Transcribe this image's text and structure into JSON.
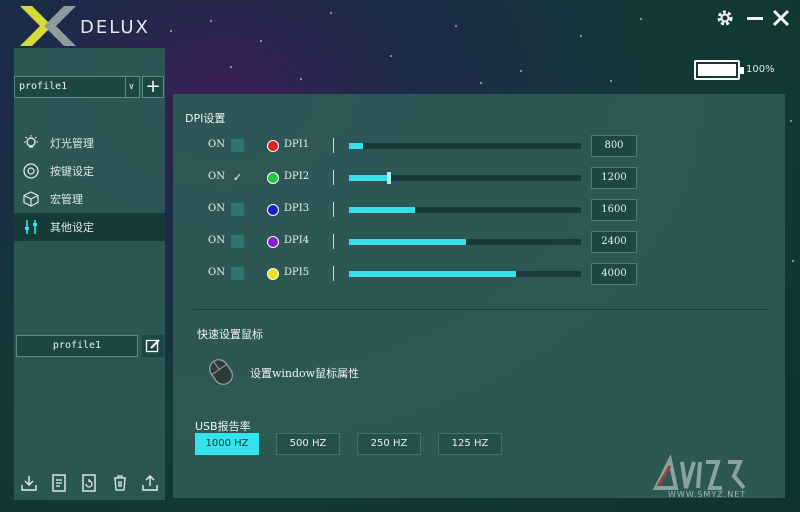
{
  "brand": {
    "logo_text": "DELUX"
  },
  "topbar": {
    "battery_text": "100%"
  },
  "sidebar": {
    "profile_select_value": "profile1",
    "profile_name": "profile1",
    "items": [
      {
        "label": "灯光管理",
        "icon": "light-bulb-icon"
      },
      {
        "label": "按键设定",
        "icon": "mouse-buttons-icon"
      },
      {
        "label": "宏管理",
        "icon": "macro-cube-icon"
      },
      {
        "label": "其他设定",
        "icon": "sliders-icon"
      }
    ],
    "bottom_tools": [
      "import-icon",
      "document-icon",
      "refresh-icon",
      "trash-icon",
      "export-icon"
    ]
  },
  "dpi": {
    "title": "DPI设置",
    "rows": [
      {
        "on": "ON",
        "enabled": false,
        "label": "DPI1",
        "color": "#e02020",
        "value": "800",
        "fraction": 0.06
      },
      {
        "on": "ON",
        "enabled": true,
        "label": "DPI2",
        "color": "#22c83a",
        "value": "1200",
        "fraction": 0.17
      },
      {
        "on": "ON",
        "enabled": false,
        "label": "DPI3",
        "color": "#1822c8",
        "value": "1600",
        "fraction": 0.28
      },
      {
        "on": "ON",
        "enabled": false,
        "label": "DPI4",
        "color": "#8a1ed0",
        "value": "2400",
        "fraction": 0.5
      },
      {
        "on": "ON",
        "enabled": false,
        "label": "DPI5",
        "color": "#f2e21a",
        "value": "4000",
        "fraction": 0.72
      }
    ]
  },
  "quick": {
    "title": "快速设置鼠标",
    "windows_label": "设置window鼠标属性"
  },
  "usb": {
    "title": "USB报告率",
    "rates": [
      {
        "label": "1000 HZ",
        "active": true
      },
      {
        "label": "500 HZ",
        "active": false
      },
      {
        "label": "250 HZ",
        "active": false
      },
      {
        "label": "125 HZ",
        "active": false
      }
    ]
  },
  "watermark": {
    "text": "WWW.SMYZ.NET"
  }
}
